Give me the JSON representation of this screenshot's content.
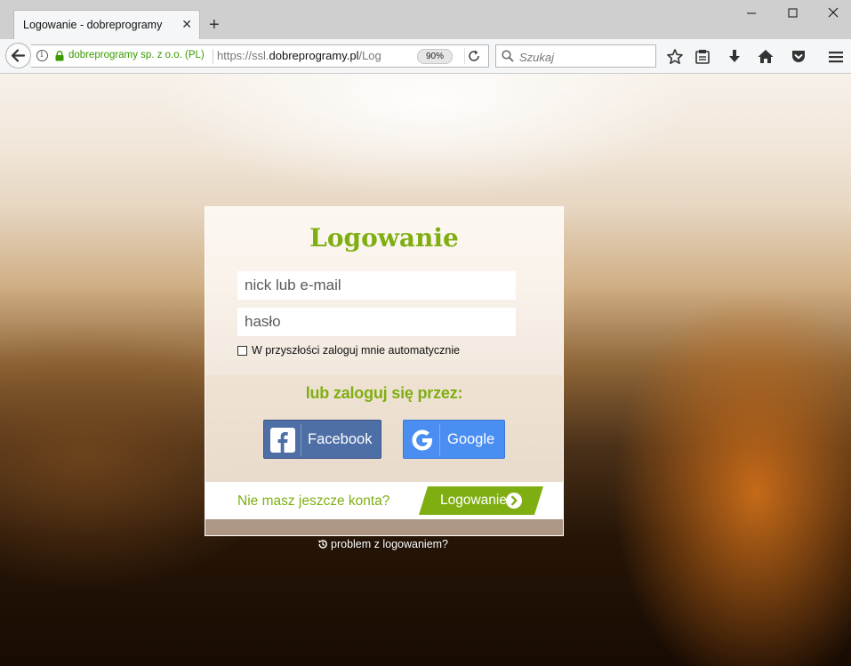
{
  "browser": {
    "tab_title": "Logowanie - dobreprogramy",
    "site_identity": "dobreprogramy sp. z o.o. (PL)",
    "url_prefix": "https://ssl.",
    "url_domain": "dobreprogramy.pl",
    "url_suffix": "/Log",
    "zoom": "90%",
    "search_placeholder": "Szukaj",
    "colors": {
      "chrome": "#cfcfcf",
      "toolbar": "#f5f6f7",
      "secure": "#3a9b00"
    },
    "toolbar_icons": [
      "bookmark-star-icon",
      "reading-list-icon",
      "download-icon",
      "home-icon",
      "pocket-icon",
      "menu-icon"
    ]
  },
  "login": {
    "title": "Logowanie",
    "nick_placeholder": "nick lub e-mail",
    "password_placeholder": "hasło",
    "remember_label": "W przyszłości zaloguj mnie automatycznie",
    "social_heading": "lub zaloguj się przez:",
    "facebook_label": "Facebook",
    "google_label": "Google",
    "no_account_text": "Nie masz jeszcze konta?",
    "register_button_label": "Logowanie",
    "problem_link": "problem z logowaniem?",
    "colors": {
      "accent": "#7fae12",
      "facebook": "#4e6fa6",
      "google": "#4a8ef1"
    }
  }
}
